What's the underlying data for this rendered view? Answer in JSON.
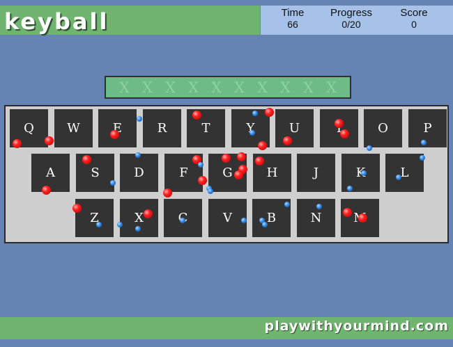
{
  "header": {
    "title": "keyball",
    "stats": {
      "time_label": "Time",
      "time_value": "66",
      "progress_label": "Progress",
      "progress_value": "0/20",
      "score_label": "Score",
      "score_value": "0"
    }
  },
  "word_slots": [
    "X",
    "X",
    "X",
    "X",
    "X",
    "X",
    "X",
    "X",
    "X",
    "X"
  ],
  "keyboard": {
    "rows": [
      [
        "Q",
        "W",
        "E",
        "R",
        "T",
        "Y",
        "U",
        "I",
        "O",
        "P"
      ],
      [
        "A",
        "S",
        "D",
        "F",
        "G",
        "H",
        "J",
        "K",
        "L"
      ],
      [
        "Z",
        "X",
        "C",
        "V",
        "B",
        "N",
        "M"
      ]
    ]
  },
  "footer": {
    "site": "playwithyourmind.com"
  },
  "colors": {
    "background": "#6583b3",
    "bar_green": "#6fb56f",
    "stats_panel": "#a7c2e8",
    "key": "#333333",
    "keyboard_bg": "#cfcfcf",
    "word_display": "#6dbb86",
    "ball_red": "#ff2020",
    "ball_blue": "#2f86e8"
  }
}
